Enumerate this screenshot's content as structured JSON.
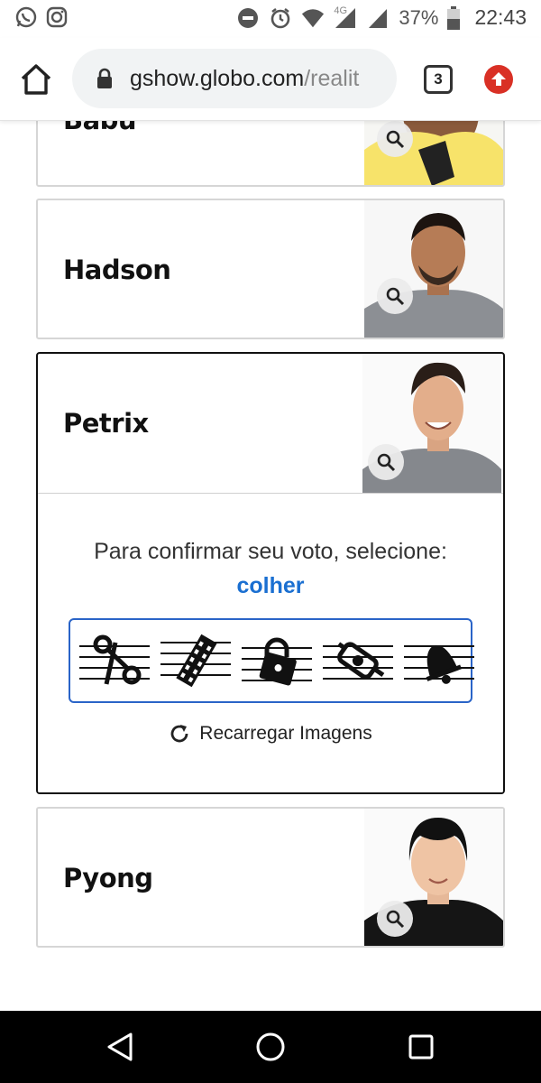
{
  "status_bar": {
    "network": "4G",
    "battery": "37%",
    "time": "22:43",
    "icons": [
      "whatsapp-icon",
      "instagram-icon",
      "do-not-disturb-icon",
      "alarm-icon",
      "wifi-icon",
      "signal-icon",
      "signal-icon",
      "battery-icon"
    ]
  },
  "browser": {
    "url_domain": "gshow.globo.com",
    "url_path": "/realit",
    "tab_count": "3",
    "icons": [
      "home-icon",
      "lock-icon",
      "tabs-icon",
      "update-arrow-icon"
    ]
  },
  "participants": [
    {
      "name": "Babu",
      "selected": false
    },
    {
      "name": "Hadson",
      "selected": false
    },
    {
      "name": "Petrix",
      "selected": true
    },
    {
      "name": "Pyong",
      "selected": false
    }
  ],
  "captcha": {
    "prompt": "Para confirmar seu voto, selecione:",
    "target_word": "colher",
    "options": [
      "scissors",
      "film-strip",
      "padlock",
      "key-cutter",
      "bell"
    ],
    "reload_label": "Recarregar Imagens",
    "accent_color": "#1a6fd1",
    "border_color": "#2a64c8"
  },
  "nav_bar": {
    "icons": [
      "back-icon",
      "home-circle-icon",
      "recents-icon"
    ]
  }
}
